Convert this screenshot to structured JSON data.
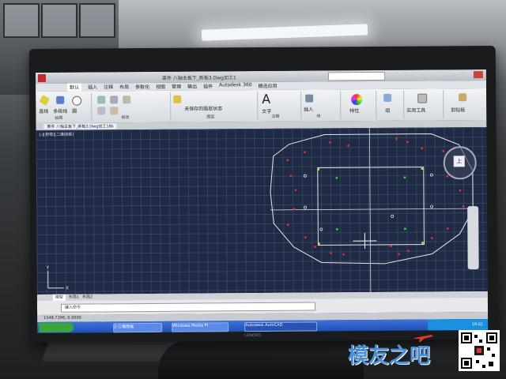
{
  "window": {
    "title": "某件 八轴主板下_新板3.Dwg加工1"
  },
  "ribbon_tabs": [
    "默认",
    "插入",
    "注释",
    "布局",
    "参数化",
    "视图",
    "管理",
    "输出",
    "插件",
    "Autodesk 360",
    "精选应用"
  ],
  "ribbon_groups": [
    {
      "label": "绘图"
    },
    {
      "label": "修改"
    },
    {
      "label": "图层"
    },
    {
      "label": "注释"
    },
    {
      "label": "块"
    },
    {
      "label": "特性"
    },
    {
      "label": "组"
    },
    {
      "label": "实用工具"
    },
    {
      "label": "剪贴板"
    }
  ],
  "ribbon_buttons": {
    "line": "直线",
    "polyline": "多段线",
    "circle": "圆",
    "arc": "圆弧",
    "text": "文字",
    "insert": "插入",
    "properties": "特性",
    "group": "组",
    "utilities": "实用工具",
    "clipboard": "剪贴板"
  },
  "layer_state": "未保存的图层状态",
  "document_tab": "某件 八轴主板下_新板3.Dwg加工1Bk",
  "viewport_label": "[-][俯视][二维线框]",
  "viewcube": {
    "face": "上"
  },
  "layout_tabs": [
    "模型",
    "布局1",
    "布局2"
  ],
  "command_prompt": "键入命令",
  "status_coords": "1548.7396, 0.0000",
  "taskbar_items": [
    "2-三维图框",
    "Windows Media Pl",
    "Autodesk AutoCAD"
  ],
  "clock": "19:01",
  "bezel_brand": "LENOVO",
  "watermark_text": "模友之吧",
  "colors": {
    "viewport_bg": "#1f2a44",
    "outline": "#e8e8e8",
    "red_point": "#e03030",
    "green_point": "#39d43a",
    "yellow_point": "#e0d840",
    "ribbon_bg": "#e4e8ec",
    "taskbar": "#2a5cc6"
  }
}
